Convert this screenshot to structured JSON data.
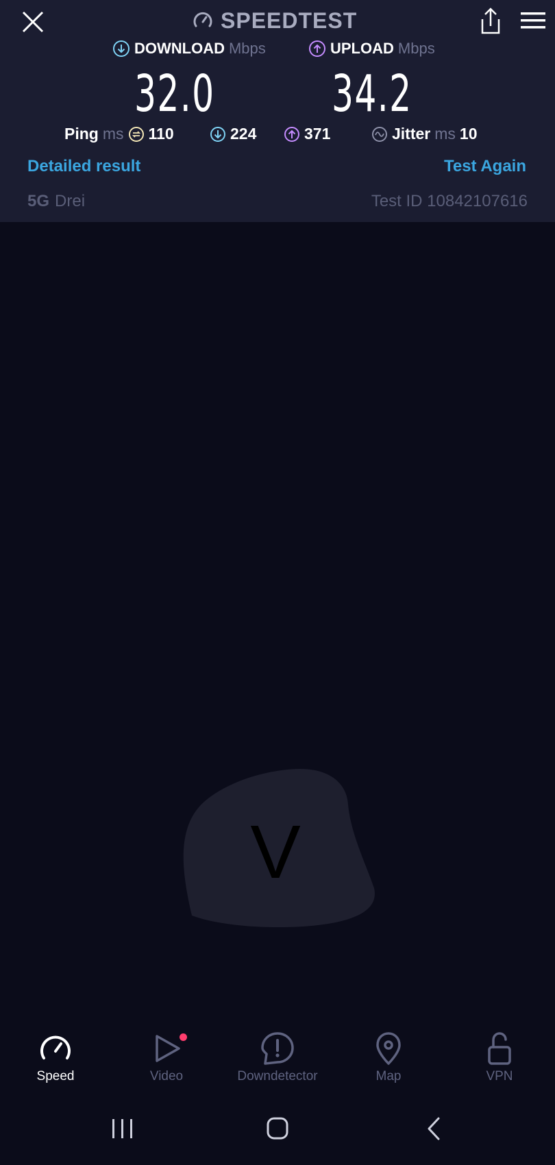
{
  "header": {
    "brand": "SPEEDTEST",
    "close_icon": "close-icon",
    "share_icon": "share-icon",
    "menu_icon": "menu-icon"
  },
  "results": {
    "download_label": "DOWNLOAD",
    "download_unit": "Mbps",
    "download_value": "32.0",
    "upload_label": "UPLOAD",
    "upload_unit": "Mbps",
    "upload_value": "34.2"
  },
  "stats": {
    "ping_label": "Ping",
    "ping_unit": "ms",
    "ping_idle": "110",
    "ping_download": "224",
    "ping_upload": "371",
    "jitter_label": "Jitter",
    "jitter_unit": "ms",
    "jitter_value": "10"
  },
  "actions": {
    "detailed": "Detailed result",
    "again": "Test Again"
  },
  "connection": {
    "network": "5G",
    "operator": "Drei",
    "test_id": "Test ID 10842107616"
  },
  "badge": {
    "letter": "V"
  },
  "tabs": [
    {
      "label": "Speed",
      "icon": "speedometer-icon",
      "active": true
    },
    {
      "label": "Video",
      "icon": "play-icon",
      "active": false
    },
    {
      "label": "Downdetector",
      "icon": "alert-icon",
      "active": false
    },
    {
      "label": "Map",
      "icon": "map-pin-icon",
      "active": false
    },
    {
      "label": "VPN",
      "icon": "lock-icon",
      "active": false
    }
  ],
  "colors": {
    "accent_link": "#3ba6e0",
    "download_icon": "#7fd3f5",
    "upload_icon": "#c58cff",
    "notification_dot": "#ff3d6e"
  }
}
